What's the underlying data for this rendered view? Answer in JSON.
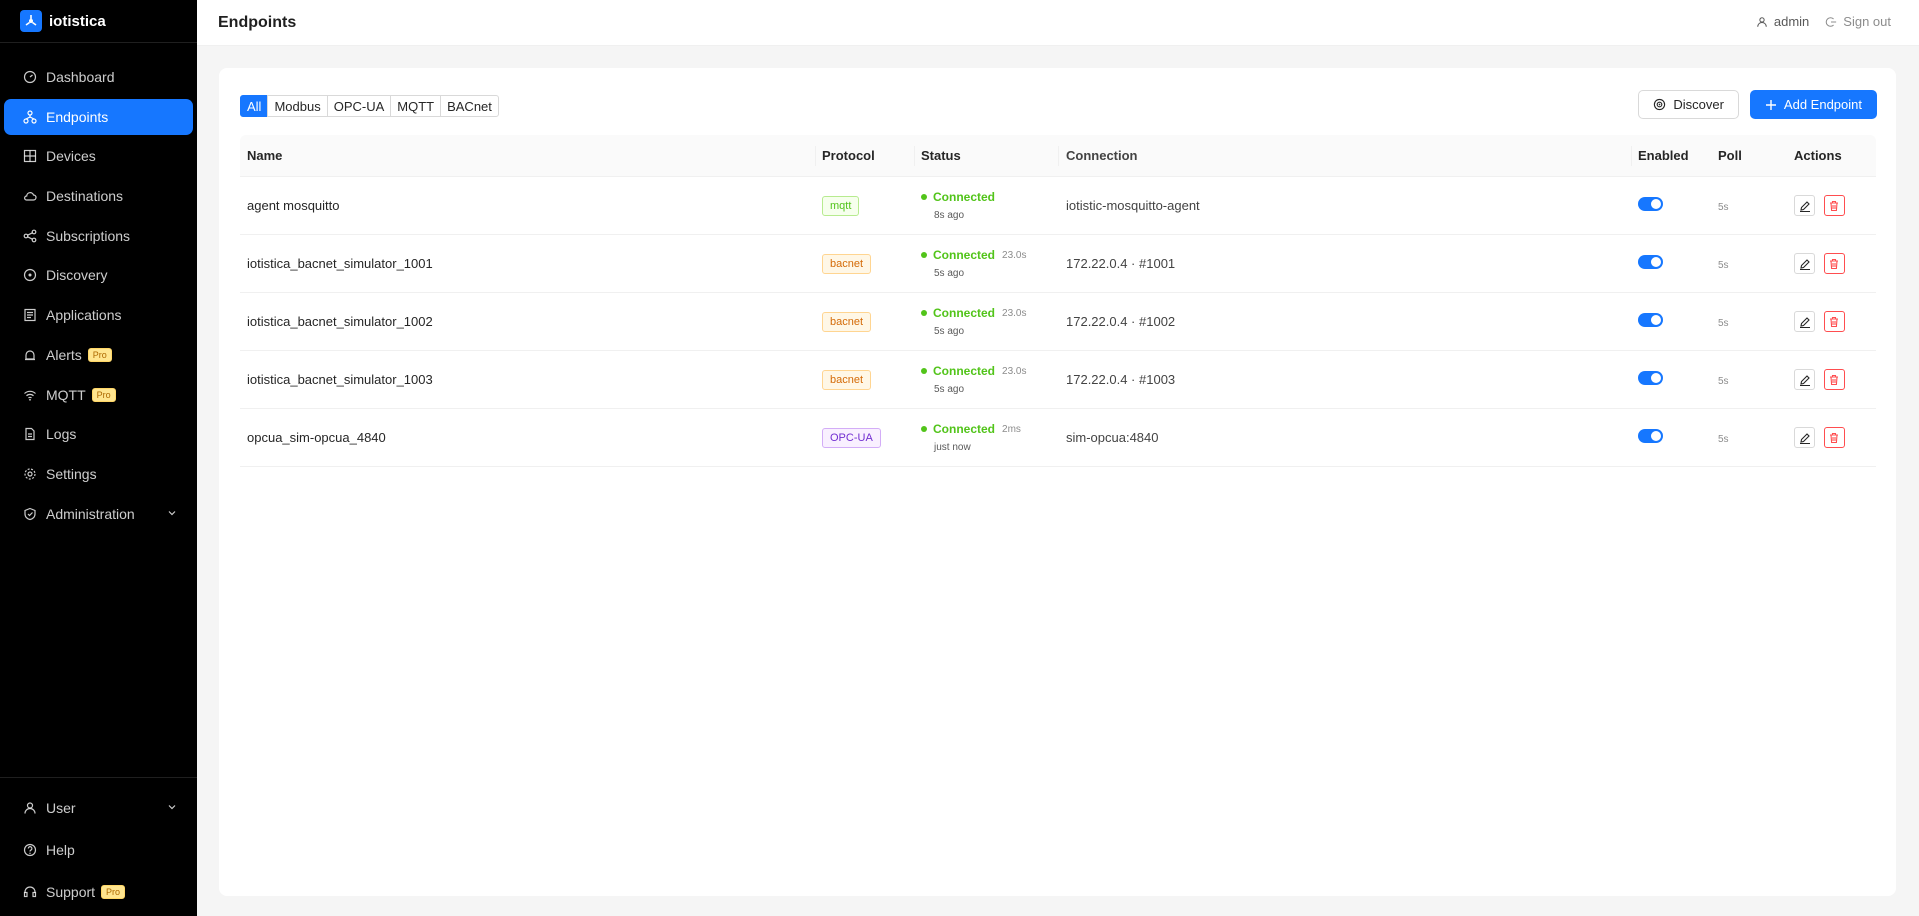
{
  "brand": {
    "name": "iotistica"
  },
  "header": {
    "title": "Endpoints",
    "user": "admin",
    "signout": "Sign out"
  },
  "sidebar": {
    "items": [
      {
        "label": "Dashboard"
      },
      {
        "label": "Endpoints",
        "active": true
      },
      {
        "label": "Devices"
      },
      {
        "label": "Destinations"
      },
      {
        "label": "Subscriptions"
      },
      {
        "label": "Discovery"
      },
      {
        "label": "Applications"
      },
      {
        "label": "Alerts",
        "badge": "Pro"
      },
      {
        "label": "MQTT",
        "badge": "Pro"
      },
      {
        "label": "Logs"
      },
      {
        "label": "Settings"
      },
      {
        "label": "Administration"
      }
    ],
    "bottom": [
      {
        "label": "User"
      },
      {
        "label": "Help"
      },
      {
        "label": "Support",
        "badge": "Pro"
      }
    ]
  },
  "filters": [
    "All",
    "Modbus",
    "OPC-UA",
    "MQTT",
    "BACnet"
  ],
  "toolbar": {
    "discover": "Discover",
    "add": "Add Endpoint"
  },
  "table": {
    "columns": [
      "Name",
      "Protocol",
      "Status",
      "Connection",
      "Enabled",
      "Poll",
      "Actions"
    ],
    "rows": [
      {
        "name": "agent mosquitto",
        "protocol": "mqtt",
        "status": "Connected",
        "latency": "",
        "ago": "8s ago",
        "connection": "iotistic-mosquitto-agent",
        "poll": "5s"
      },
      {
        "name": "iotistica_bacnet_simulator_1001",
        "protocol": "bacnet",
        "status": "Connected",
        "latency": "23.0s",
        "ago": "5s ago",
        "connection": "172.22.0.4 · #1001",
        "poll": "5s"
      },
      {
        "name": "iotistica_bacnet_simulator_1002",
        "protocol": "bacnet",
        "status": "Connected",
        "latency": "23.0s",
        "ago": "5s ago",
        "connection": "172.22.0.4 · #1002",
        "poll": "5s"
      },
      {
        "name": "iotistica_bacnet_simulator_1003",
        "protocol": "bacnet",
        "status": "Connected",
        "latency": "23.0s",
        "ago": "5s ago",
        "connection": "172.22.0.4 · #1003",
        "poll": "5s"
      },
      {
        "name": "opcua_sim-opcua_4840",
        "protocol": "OPC-UA",
        "status": "Connected",
        "latency": "2ms",
        "ago": "just now",
        "connection": "sim-opcua:4840",
        "poll": "5s"
      }
    ]
  },
  "colors": {
    "accent": "#1677ff",
    "sidebar_bg": "#000000",
    "success": "#52c41a",
    "danger": "#ff4d4f"
  }
}
